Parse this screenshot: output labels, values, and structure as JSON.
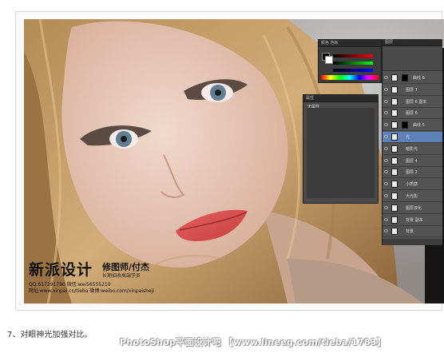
{
  "article": {
    "caption": "7、对眼神光加强对比。",
    "watermark": "PhotoShop平面设计吧 【www.lineeg.com/tieba/1783】"
  },
  "photo": {
    "brand_title": "新派设计",
    "brand_subtitle": "修图师/付杰",
    "brand_subtitle_small": "长期招收高端学员",
    "brand_contact": "QQ:617291790  微信:wei56555210",
    "brand_website": "网址:www.xinpai.cn/tieba  微博:weibo.com/xinpaisheji"
  },
  "photoshop": {
    "color_panel": {
      "tab": "颜色  色板"
    },
    "properties_panel": {
      "tab": "属性",
      "label": "无属性"
    },
    "layers_panel": {
      "tab": "图层",
      "rows": [
        {
          "name": "曲线 6",
          "mask": true,
          "selected": false
        },
        {
          "name": "图层 7",
          "mask": false,
          "selected": false
        },
        {
          "name": "图层 6 副本",
          "mask": false,
          "selected": false
        },
        {
          "name": "图层 6",
          "mask": false,
          "selected": false
        },
        {
          "name": "曲线 5",
          "mask": true,
          "selected": false
        },
        {
          "name": "光",
          "mask": false,
          "selected": true
        },
        {
          "name": "暗影光",
          "mask": false,
          "selected": false
        },
        {
          "name": "图层 4",
          "mask": false,
          "selected": false
        },
        {
          "name": "图层 2",
          "mask": false,
          "selected": false
        },
        {
          "name": "小质感",
          "mask": false,
          "selected": false
        },
        {
          "name": "大光影",
          "mask": false,
          "selected": false
        },
        {
          "name": "图层液化",
          "mask": false,
          "selected": false
        },
        {
          "name": "背景 副本",
          "mask": false,
          "selected": false
        },
        {
          "name": "背景",
          "mask": false,
          "selected": false
        }
      ]
    }
  }
}
